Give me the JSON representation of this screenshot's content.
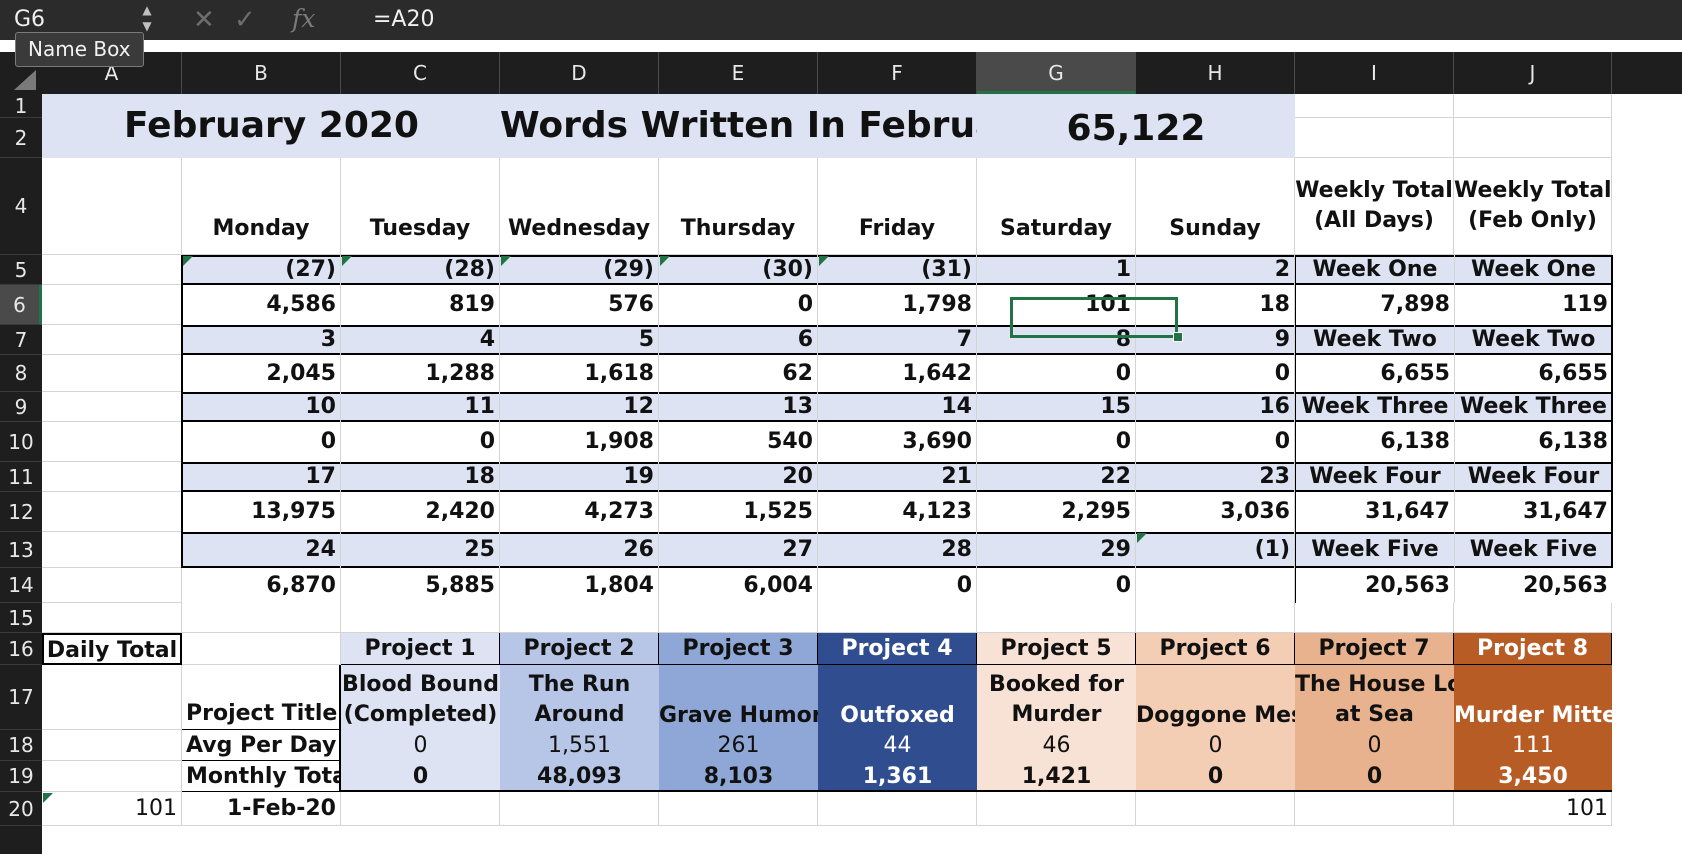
{
  "formula_bar": {
    "name_box": "G6",
    "tooltip": "Name Box",
    "formula": "=A20",
    "icons": [
      "cancel-icon",
      "enter-icon",
      "function-icon"
    ]
  },
  "columns": [
    "A",
    "B",
    "C",
    "D",
    "E",
    "F",
    "G",
    "H",
    "I",
    "J"
  ],
  "rows": [
    "1",
    "2",
    "4",
    "5",
    "6",
    "7",
    "8",
    "9",
    "10",
    "11",
    "12",
    "13",
    "14",
    "15",
    "16",
    "17",
    "18",
    "19",
    "20"
  ],
  "selected_cell": "G6",
  "header": {
    "month": "February 2020",
    "words_label": "Words Written In February:",
    "words_total": "65,122"
  },
  "days": [
    "Monday",
    "Tuesday",
    "Wednesday",
    "Thursday",
    "Friday",
    "Saturday",
    "Sunday"
  ],
  "weekly_headers": [
    "Weekly Total\n(All Days)",
    "Weekly Total\n(Feb Only)"
  ],
  "weeks": [
    {
      "dates": [
        "(27)",
        "(28)",
        "(29)",
        "(30)",
        "(31)",
        "1",
        "2"
      ],
      "label_all": "Week One",
      "label_feb": "Week One",
      "words": [
        "4,586",
        "819",
        "576",
        "0",
        "1,798",
        "101",
        "18"
      ],
      "total_all": "7,898",
      "total_feb": "119"
    },
    {
      "dates": [
        "3",
        "4",
        "5",
        "6",
        "7",
        "8",
        "9"
      ],
      "label_all": "Week Two",
      "label_feb": "Week Two",
      "words": [
        "2,045",
        "1,288",
        "1,618",
        "62",
        "1,642",
        "0",
        "0"
      ],
      "total_all": "6,655",
      "total_feb": "6,655"
    },
    {
      "dates": [
        "10",
        "11",
        "12",
        "13",
        "14",
        "15",
        "16"
      ],
      "label_all": "Week Three",
      "label_feb": "Week Three",
      "words": [
        "0",
        "0",
        "1,908",
        "540",
        "3,690",
        "0",
        "0"
      ],
      "total_all": "6,138",
      "total_feb": "6,138"
    },
    {
      "dates": [
        "17",
        "18",
        "19",
        "20",
        "21",
        "22",
        "23"
      ],
      "label_all": "Week Four",
      "label_feb": "Week Four",
      "words": [
        "13,975",
        "2,420",
        "4,273",
        "1,525",
        "4,123",
        "2,295",
        "3,036"
      ],
      "total_all": "31,647",
      "total_feb": "31,647"
    },
    {
      "dates": [
        "24",
        "25",
        "26",
        "27",
        "28",
        "29",
        "(1)"
      ],
      "label_all": "Week Five",
      "label_feb": "Week Five",
      "words": [
        "6,870",
        "5,885",
        "1,804",
        "6,004",
        "0",
        "0",
        ""
      ],
      "total_all": "20,563",
      "total_feb": "20,563"
    }
  ],
  "daily_total_label": "Daily Total",
  "project_labels": {
    "title": "Project Title",
    "avg": "Avg Per Day",
    "monthly": "Monthly Total"
  },
  "projects": [
    {
      "name": "Project 1",
      "title": "Blood Bound\n(Completed)",
      "avg": "0",
      "monthly": "0",
      "color": "#dde3f2",
      "text": "#111111"
    },
    {
      "name": "Project 2",
      "title": "The Run\nAround",
      "avg": "1,551",
      "monthly": "48,093",
      "color": "#b7c6e6",
      "text": "#111111"
    },
    {
      "name": "Project 3",
      "title": "Grave Humor",
      "avg": "261",
      "monthly": "8,103",
      "color": "#8ea7d6",
      "text": "#111111"
    },
    {
      "name": "Project 4",
      "title": "Outfoxed",
      "avg": "44",
      "monthly": "1,361",
      "color": "#2f4d8f",
      "text": "#ffffff"
    },
    {
      "name": "Project 5",
      "title": "Booked for\nMurder",
      "avg": "46",
      "monthly": "1,421",
      "color": "#f8e2d6",
      "text": "#111111"
    },
    {
      "name": "Project 6",
      "title": "Doggone Mess",
      "avg": "0",
      "monthly": "0",
      "color": "#f3cdb4",
      "text": "#111111"
    },
    {
      "name": "Project 7",
      "title": "The House Lost\nat Sea",
      "avg": "0",
      "monthly": "0",
      "color": "#e9b28e",
      "text": "#111111"
    },
    {
      "name": "Project 8",
      "title": "Murder Mittens",
      "avg": "111",
      "monthly": "3,450",
      "color": "#b85c26",
      "text": "#ffffff"
    }
  ],
  "row20": {
    "a": "101",
    "b": "1-Feb-20",
    "j": "101"
  }
}
